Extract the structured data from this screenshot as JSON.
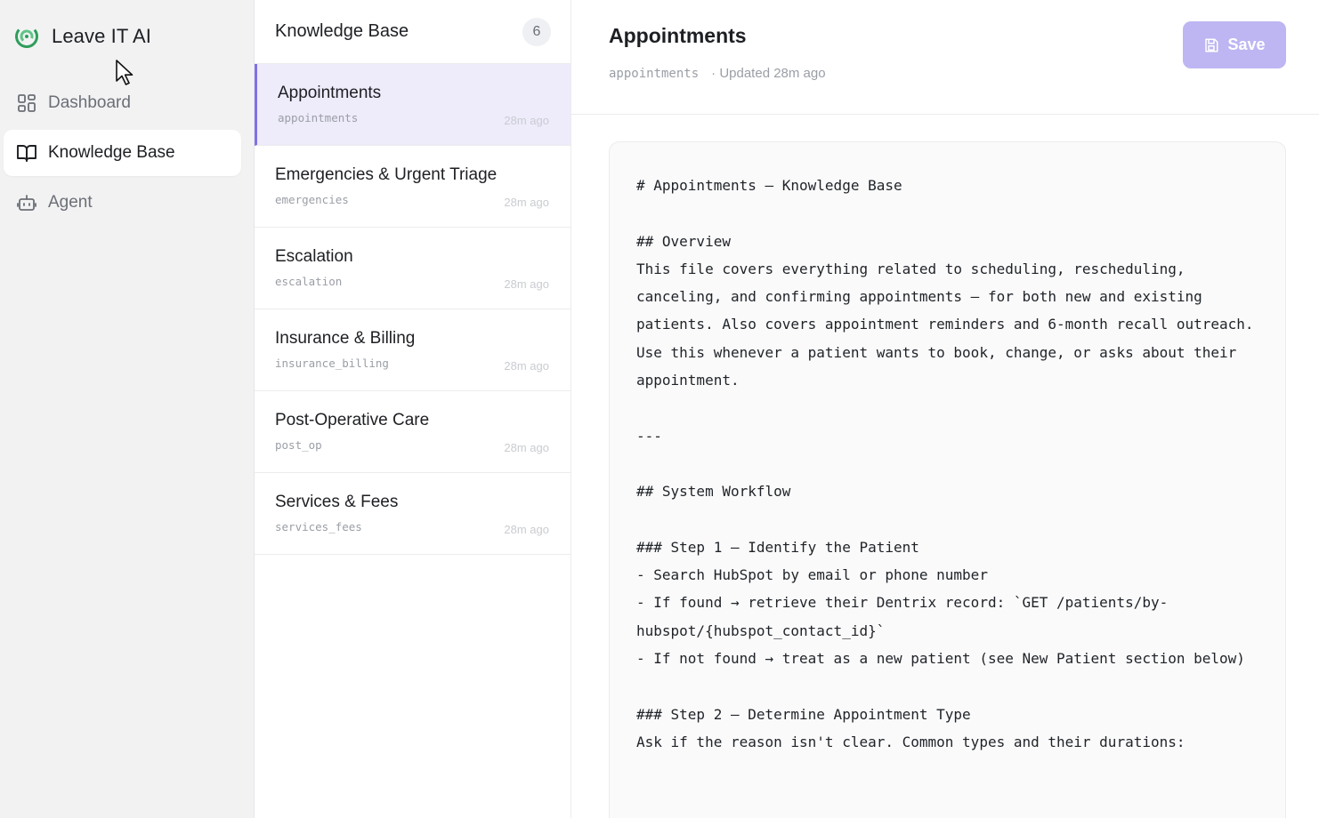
{
  "brand": {
    "name": "Leave IT AI"
  },
  "nav": [
    {
      "label": "Dashboard",
      "icon": "dashboard-icon",
      "active": false
    },
    {
      "label": "Knowledge Base",
      "icon": "book-icon",
      "active": true
    },
    {
      "label": "Agent",
      "icon": "robot-icon",
      "active": false
    }
  ],
  "list": {
    "title": "Knowledge Base",
    "count": "6",
    "items": [
      {
        "name": "Appointments",
        "slug": "appointments",
        "time": "28m ago",
        "selected": true
      },
      {
        "name": "Emergencies & Urgent Triage",
        "slug": "emergencies",
        "time": "28m ago",
        "selected": false
      },
      {
        "name": "Escalation",
        "slug": "escalation",
        "time": "28m ago",
        "selected": false
      },
      {
        "name": "Insurance & Billing",
        "slug": "insurance_billing",
        "time": "28m ago",
        "selected": false
      },
      {
        "name": "Post-Operative Care",
        "slug": "post_op",
        "time": "28m ago",
        "selected": false
      },
      {
        "name": "Services & Fees",
        "slug": "services_fees",
        "time": "28m ago",
        "selected": false
      }
    ]
  },
  "editor": {
    "title": "Appointments",
    "slug": "appointments",
    "updated": "· Updated 28m ago",
    "save_label": "Save",
    "content": "# Appointments — Knowledge Base\n\n## Overview\nThis file covers everything related to scheduling, rescheduling, canceling, and confirming appointments — for both new and existing patients. Also covers appointment reminders and 6-month recall outreach. Use this whenever a patient wants to book, change, or asks about their appointment.\n\n---\n\n## System Workflow\n\n### Step 1 — Identify the Patient\n- Search HubSpot by email or phone number\n- If found → retrieve their Dentrix record: `GET /patients/by-hubspot/{hubspot_contact_id}`\n- If not found → treat as a new patient (see New Patient section below)\n\n### Step 2 — Determine Appointment Type\nAsk if the reason isn't clear. Common types and their durations:"
  },
  "colors": {
    "accent": "#7e72e6",
    "selected_bg": "#eeebfb",
    "save_bg": "#bdb6f2",
    "logo_green": "#2e9e5b"
  }
}
